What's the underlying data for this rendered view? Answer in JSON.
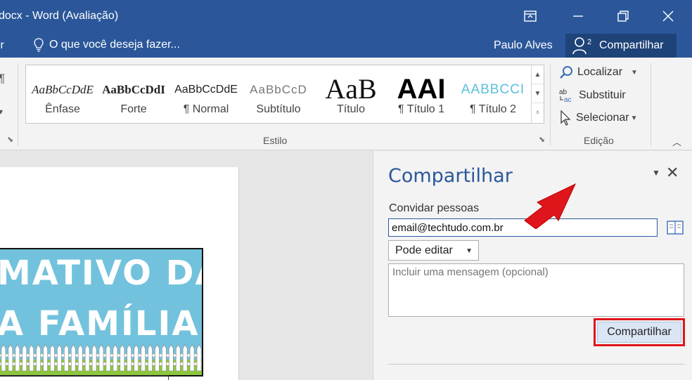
{
  "window": {
    "title": "docx - Word (Avaliação)",
    "controls": [
      "ribbon-display-options",
      "minimize",
      "restore",
      "close"
    ]
  },
  "tellbar": {
    "left_stub": "ir",
    "tell_me": "O que você deseja fazer...",
    "user": "Paulo Alves",
    "share_label": "Compartilhar"
  },
  "ribbon": {
    "styles": [
      {
        "sample": "AaBbCcDdE",
        "label": "Ênfase"
      },
      {
        "sample": "AaBbCcDdI",
        "label": "Forte"
      },
      {
        "sample": "AaBbCcDdE",
        "label": "¶ Normal"
      },
      {
        "sample": "AaBbCcD",
        "label": "Subtítulo"
      },
      {
        "sample": "AaB",
        "label": "Título"
      },
      {
        "sample": "AAI",
        "label": "¶ Título 1"
      },
      {
        "sample": "AABBCCI",
        "label": "¶ Título 2"
      }
    ],
    "style_group_label": "Estilo",
    "editing": {
      "find": "Localizar",
      "replace": "Substituir",
      "select": "Selecionar",
      "group_label": "Edição"
    }
  },
  "document": {
    "banner_line1": "MATIVO DA",
    "banner_line2": "A FAMÍLIA",
    "colors": {
      "banner": "#72c2dd",
      "grass": "#8cc63f"
    }
  },
  "share_pane": {
    "title": "Compartilhar",
    "invite_label": "Convidar pessoas",
    "email_value": "email@techtudo.com.br",
    "permission": "Pode editar",
    "message_placeholder": "Incluir uma mensagem (opcional)",
    "share_button": "Compartilhar"
  },
  "colors": {
    "accent": "#2b579a",
    "highlight": "#e0151b"
  }
}
